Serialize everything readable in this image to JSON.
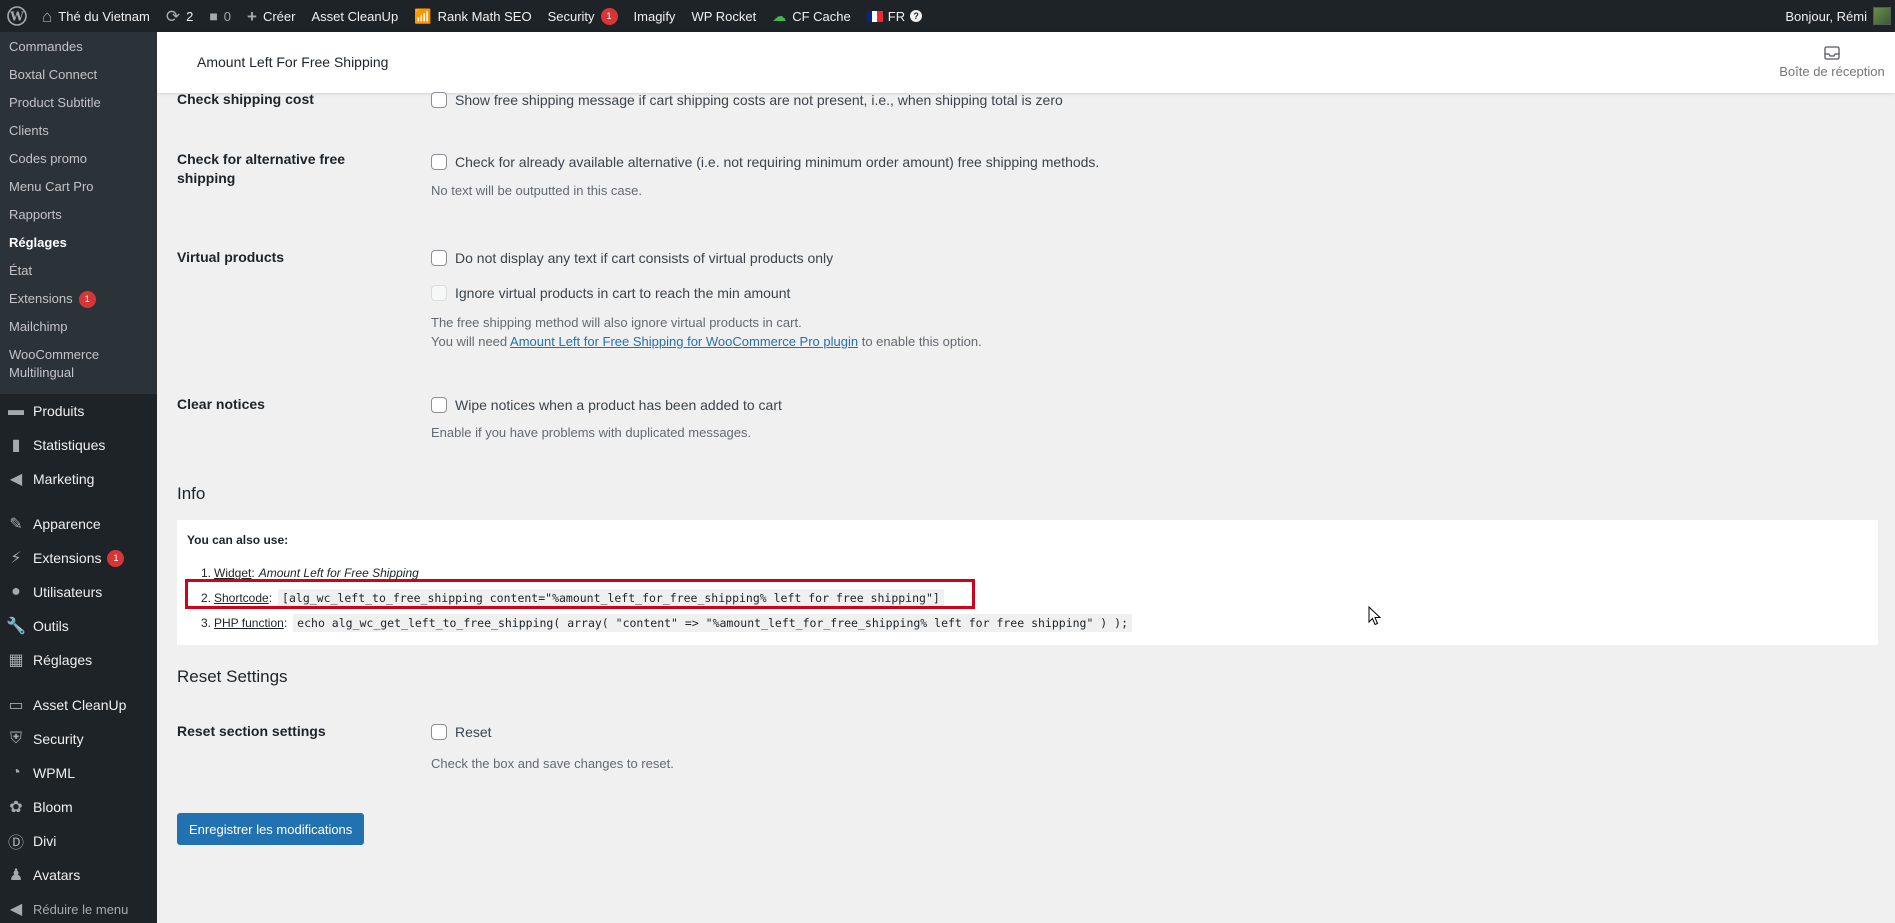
{
  "adminbar": {
    "site_name": "Thé du Vietnam",
    "updates_count": "2",
    "comments_count": "0",
    "create_label": "Créer",
    "asset_cleanup": "Asset CleanUp",
    "rank_math": "Rank Math SEO",
    "security": "Security",
    "security_badge": "1",
    "imagify": "Imagify",
    "wp_rocket": "WP Rocket",
    "cf_cache": "CF Cache",
    "lang": "FR",
    "greeting": "Bonjour, Rémi"
  },
  "sidebar": {
    "submenu": [
      {
        "label": "Commandes"
      },
      {
        "label": "Boxtal Connect"
      },
      {
        "label": "Product Subtitle"
      },
      {
        "label": "Clients"
      },
      {
        "label": "Codes promo"
      },
      {
        "label": "Menu Cart Pro"
      },
      {
        "label": "Rapports"
      },
      {
        "label": "Réglages"
      },
      {
        "label": "État"
      },
      {
        "label": "Extensions",
        "badge": "1"
      },
      {
        "label": "Mailchimp"
      },
      {
        "label": "WooCommerce Multilingual"
      }
    ],
    "menu": [
      {
        "label": "Produits",
        "icon": "archive-icon"
      },
      {
        "label": "Statistiques",
        "icon": "chart-bar-icon"
      },
      {
        "label": "Marketing",
        "icon": "megaphone-icon"
      },
      {
        "label": "Apparence",
        "icon": "paintbrush-icon"
      },
      {
        "label": "Extensions",
        "icon": "plugin-icon",
        "badge": "1"
      },
      {
        "label": "Utilisateurs",
        "icon": "user-icon"
      },
      {
        "label": "Outils",
        "icon": "wrench-icon"
      },
      {
        "label": "Réglages",
        "icon": "settings-icon"
      },
      {
        "label": "Asset CleanUp",
        "icon": "asset-cleanup-icon"
      },
      {
        "label": "Security",
        "icon": "shield-icon"
      },
      {
        "label": "WPML",
        "icon": "wpml-icon"
      },
      {
        "label": "Bloom",
        "icon": "bloom-icon"
      },
      {
        "label": "Divi",
        "icon": "divi-icon"
      },
      {
        "label": "Avatars",
        "icon": "avatar-icon"
      }
    ],
    "collapse_label": "Réduire le menu"
  },
  "header": {
    "title": "Amount Left For Free Shipping",
    "inbox_label": "Boîte de réception"
  },
  "settings": {
    "check_shipping": {
      "label": "Check shipping cost",
      "checkbox": "Show free shipping message if cart shipping costs are not present, i.e., when shipping total is zero"
    },
    "alt_free": {
      "label": "Check for alternative free shipping",
      "checkbox": "Check for already available alternative (i.e. not requiring minimum order amount) free shipping methods.",
      "desc": "No text will be outputted in this case."
    },
    "virtual": {
      "label": "Virtual products",
      "checkbox1": "Do not display any text if cart consists of virtual products only",
      "checkbox2": "Ignore virtual products in cart to reach the min amount",
      "desc1": "The free shipping method will also ignore virtual products in cart.",
      "desc2_pre": "You will need",
      "desc2_link": "Amount Left for Free Shipping for WooCommerce Pro plugin",
      "desc2_post": "to enable this option."
    },
    "clear": {
      "label": "Clear notices",
      "checkbox": "Wipe notices when a product has been added to cart",
      "desc": "Enable if you have problems with duplicated messages."
    }
  },
  "info": {
    "heading": "Info",
    "intro": "You can also use:",
    "items": [
      {
        "num": "1.",
        "link": "Widget",
        "sep": ":",
        "text": "Amount Left for Free Shipping"
      },
      {
        "num": "2.",
        "link": "Shortcode",
        "sep": ":",
        "code": "[alg_wc_left_to_free_shipping content=\"%amount_left_for_free_shipping% left for free shipping\"]"
      },
      {
        "num": "3.",
        "link": "PHP function",
        "sep": ":",
        "code": "echo alg_wc_get_left_to_free_shipping( array( \"content\" => \"%amount_left_for_free_shipping% left for free shipping\" ) );"
      }
    ]
  },
  "reset": {
    "heading": "Reset Settings",
    "label": "Reset section settings",
    "checkbox": "Reset",
    "desc": "Check the box and save changes to reset."
  },
  "save_label": "Enregistrer les modifications",
  "colors": {
    "admin_bg": "#1d2327",
    "submenu_bg": "#2c3338",
    "primary": "#2271b1",
    "badge": "#d63638",
    "highlight": "#d0021b"
  }
}
